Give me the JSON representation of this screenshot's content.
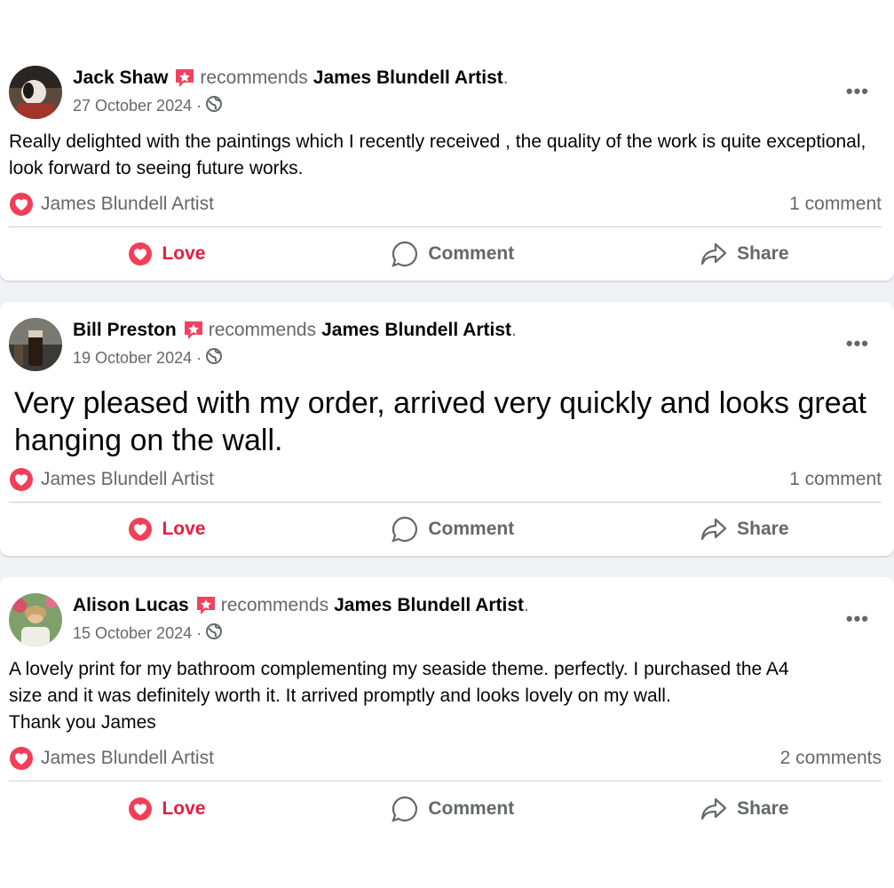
{
  "reviews": [
    {
      "author": "Jack Shaw",
      "recommends_text": "recommends",
      "page": "James Blundell Artist",
      "period": ".",
      "date": "27 October 2024",
      "separator": "·",
      "text": "Really delighted with the paintings which I recently received , the quality of the work is quite exceptional, look forward to seeing future works.",
      "reaction_name": "James Blundell Artist",
      "comments": "1 comment",
      "more": "•••"
    },
    {
      "author": "Bill Preston",
      "recommends_text": "recommends",
      "page": "James Blundell Artist",
      "period": ".",
      "date": "19 October 2024",
      "separator": "·",
      "text": "Very pleased with my order, arrived very quickly and looks great hanging on the wall.",
      "reaction_name": "James Blundell Artist",
      "comments": "1 comment",
      "more": "•••"
    },
    {
      "author": "Alison Lucas",
      "recommends_text": "recommends",
      "page": "James Blundell Artist",
      "period": ".",
      "date": "15 October 2024",
      "separator": "·",
      "text_lines": [
        "A lovely print for my bathroom complementing my seaside theme. perfectly. I purchased the A4",
        "size and it was definitely worth it. It arrived promptly and looks lovely on my wall.",
        "Thank you James"
      ],
      "reaction_name": "James Blundell Artist",
      "comments": "2 comments",
      "more": "•••"
    }
  ],
  "actions": {
    "love": "Love",
    "comment": "Comment",
    "share": "Share"
  },
  "icons": {
    "recommend": "recommend-star-icon",
    "audience": "globe-icon",
    "love": "heart-icon",
    "comment": "speech-bubble-icon",
    "share": "share-arrow-icon"
  },
  "colors": {
    "love": "#e41e3f",
    "secondary_text": "#65676b",
    "recommend_badge": "#f3425f"
  }
}
